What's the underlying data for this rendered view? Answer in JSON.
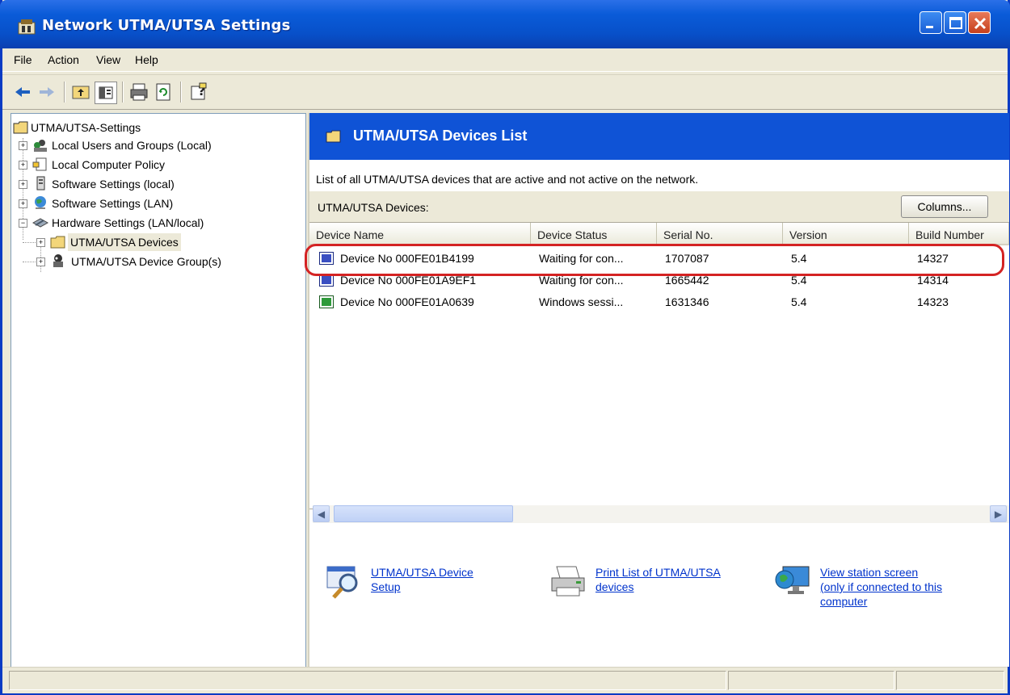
{
  "window": {
    "title": "Network UTMA/UTSA Settings",
    "colors": {
      "titlebar": "#0a5bd8",
      "banner": "#0f53d6",
      "link": "#0033cc",
      "highlight": "#d42323"
    }
  },
  "menu": [
    {
      "label": "File"
    },
    {
      "label": "Action"
    },
    {
      "label": "View"
    },
    {
      "label": "Help"
    }
  ],
  "toolbar": {
    "icons": [
      "back-arrow-icon",
      "forward-arrow-icon",
      "up-folder-icon",
      "show-hide-tree-icon",
      "print-icon",
      "refresh-icon",
      "help-icon"
    ]
  },
  "tree": {
    "root": "UTMA/UTSA-Settings",
    "items": [
      {
        "label": "Local Users and Groups (Local)",
        "icon": "users-icon"
      },
      {
        "label": "Local Computer Policy",
        "icon": "policy-icon"
      },
      {
        "label": "Software Settings (local)",
        "icon": "software-icon"
      },
      {
        "label": "Software Settings (LAN)",
        "icon": "globe-icon"
      },
      {
        "label": "Hardware Settings (LAN/local)",
        "icon": "hardware-icon"
      },
      {
        "label": "UTMA/UTSA Devices",
        "icon": "folder-icon",
        "selected": true
      },
      {
        "label": "UTMA/UTSA Device Group(s)",
        "icon": "group-icon"
      }
    ]
  },
  "panel": {
    "title": "UTMA/UTSA Devices List",
    "description": "List of all UTMA/UTSA devices that are active and not active on the network.",
    "devices_label": "UTMA/UTSA Devices:",
    "columns_button": "Columns..."
  },
  "table": {
    "headers": [
      "Device Name",
      "Device Status",
      "Serial No.",
      "Version",
      "Build Number"
    ],
    "rows": [
      {
        "name": "Device No  000FE01B4199",
        "status": "Waiting for con...",
        "serial": "1707087",
        "version": "5.4",
        "build": "14327",
        "icon_color": "#3a4fc2"
      },
      {
        "name": "Device No  000FE01A9EF1",
        "status": "Waiting for con...",
        "serial": "1665442",
        "version": "5.4",
        "build": "14314",
        "icon_color": "#3a4fc2"
      },
      {
        "name": "Device No  000FE01A0639",
        "status": "Windows sessi...",
        "serial": "1631346",
        "version": "5.4",
        "build": "14323",
        "icon_color": "#2e9a3a"
      }
    ]
  },
  "links": [
    {
      "text_line1": "UTMA/UTSA Device",
      "text_line2": "Setup",
      "icon": "magnifier-setup-icon"
    },
    {
      "text_line1": "Print List of UTMA/UTSA",
      "text_line2": "devices",
      "icon": "printer-icon"
    },
    {
      "text_line1": "View station screen",
      "text_line2": "(only if connected to this",
      "text_line3": "computer",
      "icon": "monitor-globe-icon"
    }
  ]
}
